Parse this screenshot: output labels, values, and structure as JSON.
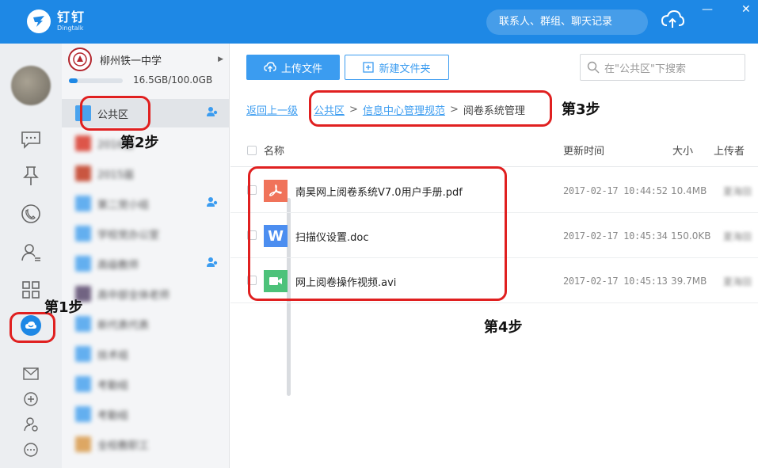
{
  "app": {
    "title_cn": "钉钉",
    "title_en": "Dingtalk"
  },
  "header": {
    "search_placeholder": "联系人、群组、聊天记录",
    "minimize": "—",
    "close": "✕"
  },
  "org": {
    "school_name": "柳州铁一中学",
    "storage_text": "16.5GB/100.0GB",
    "storage_ratio": 0.165,
    "items": [
      {
        "label": "公共区",
        "color": "#4aa3ee",
        "shared": true
      },
      {
        "label": "2016届",
        "color": "#d93a2b",
        "shared": false
      },
      {
        "label": "2015届",
        "color": "#c23b21",
        "shared": false
      },
      {
        "label": "第二党小组",
        "color": "#4aa3ee",
        "shared": true
      },
      {
        "label": "学校党办公室",
        "color": "#4aa3ee",
        "shared": false
      },
      {
        "label": "高级教师",
        "color": "#4aa3ee",
        "shared": true
      },
      {
        "label": "高中部全体老师",
        "color": "#5b4a6e",
        "shared": false
      },
      {
        "label": "新代表代表",
        "color": "#4aa3ee",
        "shared": false
      },
      {
        "label": "技术组",
        "color": "#4aa3ee",
        "shared": false
      },
      {
        "label": "考勤组",
        "color": "#4aa3ee",
        "shared": false
      },
      {
        "label": "考勤组",
        "color": "#4aa3ee",
        "shared": false
      },
      {
        "label": "全校教职工",
        "color": "#d99a4a",
        "shared": false
      }
    ]
  },
  "toolbar": {
    "upload": "上传文件",
    "new_folder": "新建文件夹",
    "search_placeholder": "在\"公共区\"下搜索"
  },
  "breadcrumb": {
    "back": "返回上一级",
    "sep": ">",
    "level1": "公共区",
    "level2": "信息中心管理规范",
    "current": "阅卷系统管理"
  },
  "table": {
    "headers": {
      "name": "名称",
      "time": "更新时间",
      "size": "大小",
      "uploader": "上传者"
    },
    "rows": [
      {
        "name": "南昊网上阅卷系统V7.0用户手册.pdf",
        "time": "2017-02-17 10:44:52",
        "size": "10.4MB",
        "uploader": "夏海田",
        "type": "pdf",
        "color": "#f0735a",
        "glyph": ""
      },
      {
        "name": "扫描仪设置.doc",
        "time": "2017-02-17 10:45:34",
        "size": "150.0KB",
        "uploader": "夏海田",
        "type": "doc",
        "color": "#4c8ef0",
        "glyph": "W"
      },
      {
        "name": "网上阅卷操作视频.avi",
        "time": "2017-02-17 10:45:13",
        "size": "39.7MB",
        "uploader": "夏海田",
        "type": "avi",
        "color": "#4dc27a",
        "glyph": ""
      }
    ]
  },
  "annotations": {
    "step1": "第1步",
    "step2": "第2步",
    "step3": "第3步",
    "step4": "第4步"
  }
}
